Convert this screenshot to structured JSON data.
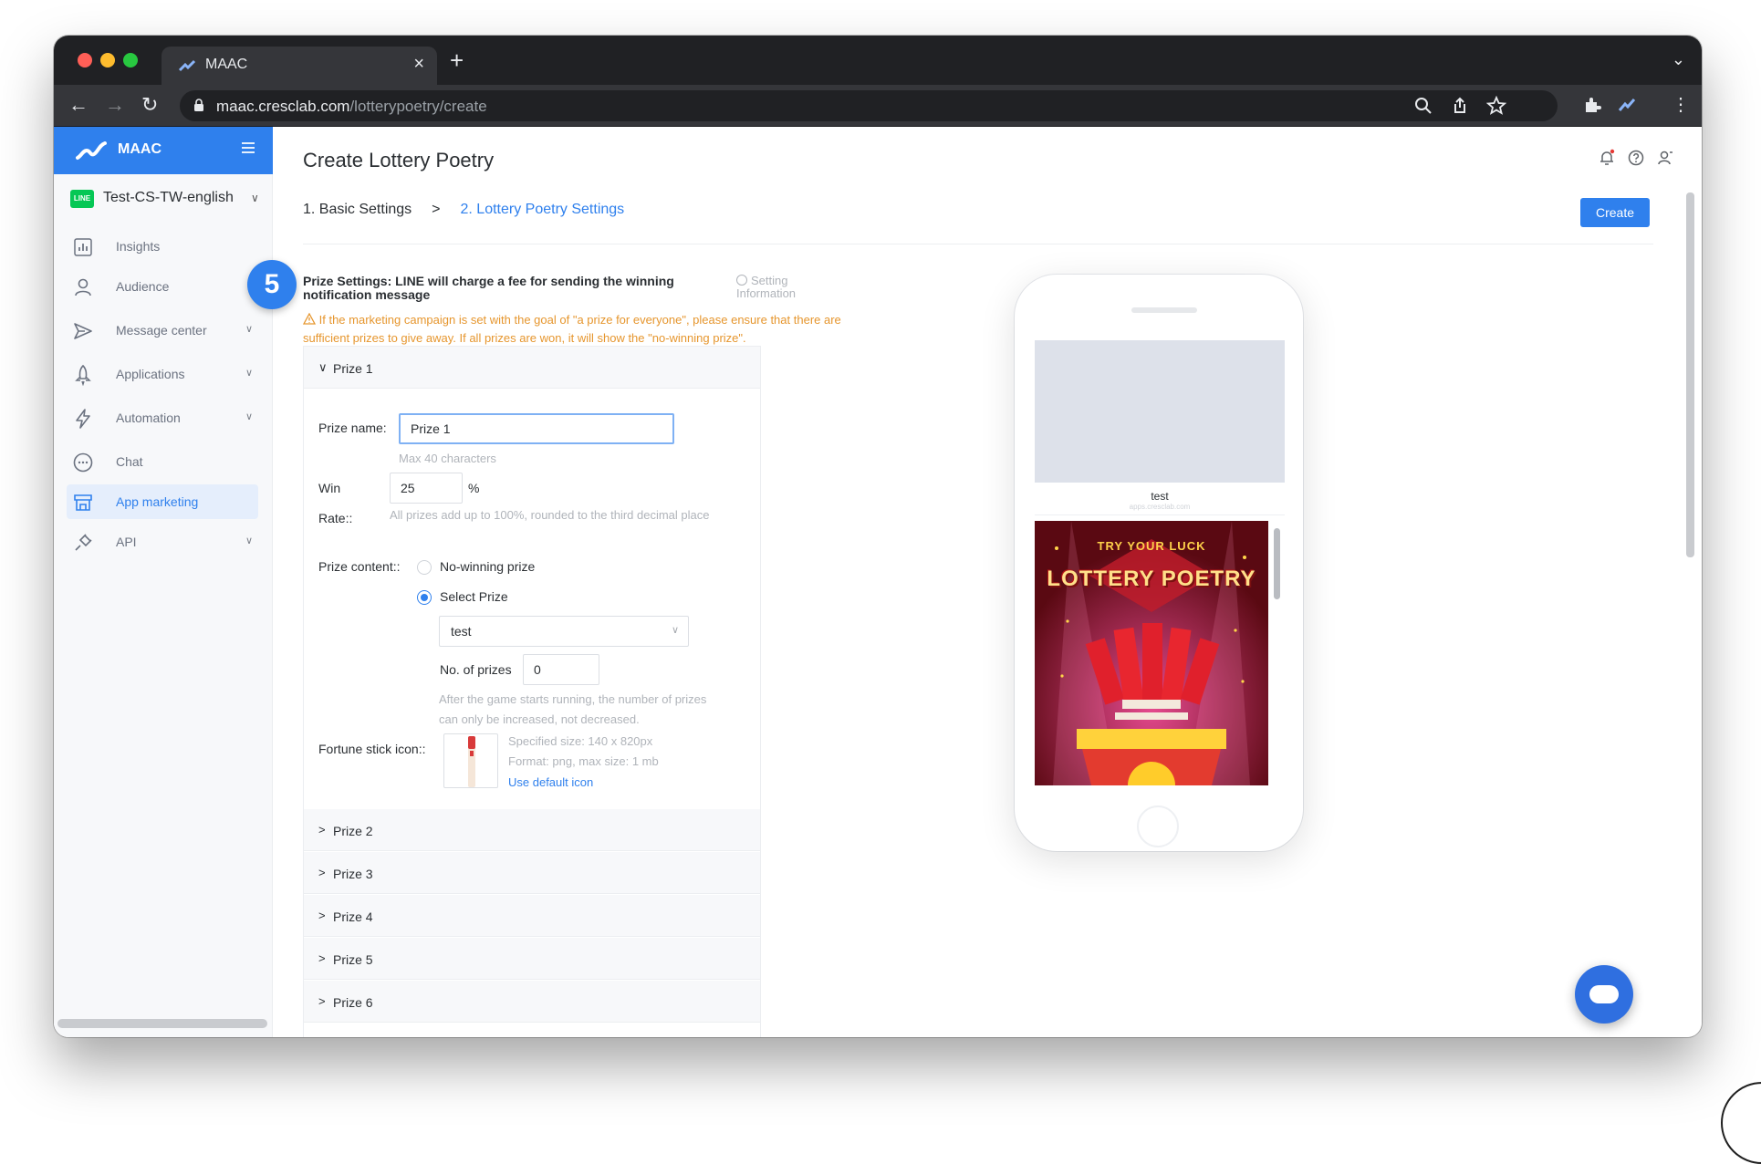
{
  "browser": {
    "tab_title": "MAAC",
    "url_host": "maac.cresclab.com",
    "url_path": "/lotterypoetry/create"
  },
  "sidebar": {
    "brand": "MAAC",
    "workspace_badge": "LINE",
    "workspace": "Test-CS-TW-english",
    "items": [
      {
        "label": "Insights",
        "icon": "bar-chart-icon",
        "has_caret": false
      },
      {
        "label": "Audience",
        "icon": "user-icon",
        "has_caret": false
      },
      {
        "label": "Message center",
        "icon": "send-icon",
        "has_caret": true
      },
      {
        "label": "Applications",
        "icon": "rocket-icon",
        "has_caret": true
      },
      {
        "label": "Automation",
        "icon": "lightning-icon",
        "has_caret": true
      },
      {
        "label": "Chat",
        "icon": "chat-icon",
        "has_caret": false
      },
      {
        "label": "App marketing",
        "icon": "store-icon",
        "has_caret": false,
        "active": true
      },
      {
        "label": "API",
        "icon": "plug-icon",
        "has_caret": true
      }
    ]
  },
  "main": {
    "title": "Create Lottery Poetry",
    "steps": {
      "step1": "1. Basic Settings",
      "separator": ">",
      "step2": "2. Lottery Poetry Settings"
    },
    "create_label": "Create",
    "annotation_number": "5",
    "section_title": "Prize Settings: LINE will charge a fee for sending the winning notification message",
    "setting_info_1": "Setting",
    "setting_info_2": "Information",
    "warning": "If the marketing campaign is set with the goal of \"a prize for everyone\", please ensure that there are sufficient prizes to give away. If all prizes are won, it will show the \"no-winning prize\".",
    "prize1": {
      "header": "Prize 1",
      "name_label": "Prize name:",
      "name_value": "Prize 1",
      "name_hint": "Max 40 characters",
      "win_label_1": "Win",
      "win_label_2": "Rate::",
      "win_value": "25",
      "win_unit": "%",
      "win_hint": "All prizes add up to 100%, rounded to the third decimal place",
      "content_label": "Prize content::",
      "option_no_win": "No-winning prize",
      "option_select": "Select Prize",
      "selected_prize": "test",
      "count_label": "No. of prizes",
      "count_value": "0",
      "count_hint": "After the game starts running, the number of prizes can only be increased, not decreased.",
      "icon_label": "Fortune stick icon::",
      "icon_hint_1": "Specified size: 140 x 820px",
      "icon_hint_2": "Format: png, max size: 1 mb",
      "icon_link": "Use default icon"
    },
    "other_prizes": [
      "Prize 2",
      "Prize 3",
      "Prize 4",
      "Prize 5",
      "Prize 6"
    ]
  },
  "preview": {
    "title": "test",
    "subtitle": "apps.cresclab.com",
    "poster_line1": "TRY YOUR LUCK",
    "poster_line2": "LOTTERY POETRY"
  },
  "colors": {
    "accent": "#2f80ed",
    "warning": "#e6962e",
    "line_green": "#06c755"
  }
}
